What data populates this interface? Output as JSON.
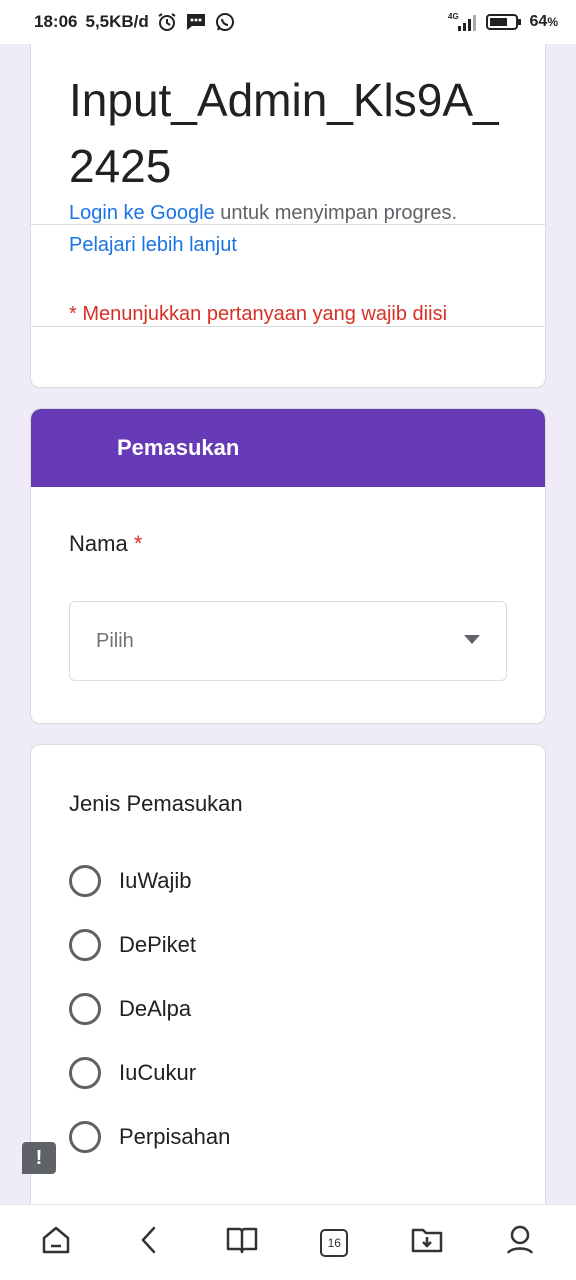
{
  "status_bar": {
    "time": "18:06",
    "net_speed": "5,5KB/d",
    "network": "4G",
    "battery": "64",
    "battery_unit": "%"
  },
  "form": {
    "title": "Input_Admin_Kls9A_2425",
    "login_link": "Login ke Google",
    "login_text": " untuk menyimpan progres. ",
    "learn_more": "Pelajari lebih lanjut",
    "required_note": "* Menunjukkan pertanyaan yang wajib diisi"
  },
  "section": {
    "title": "Pemasukan",
    "question_label": "Nama",
    "required_mark": "*",
    "dropdown_placeholder": "Pilih"
  },
  "question2": {
    "label": "Jenis Pemasukan",
    "options": [
      "IuWajib",
      "DePiket",
      "DeAlpa",
      "IuCukur",
      "Perpisahan"
    ]
  },
  "bottom_nav": {
    "tab_count": "16"
  },
  "colors": {
    "accent": "#673ab7",
    "background": "#efebf8",
    "link": "#1a73e8",
    "required": "#d93025"
  }
}
